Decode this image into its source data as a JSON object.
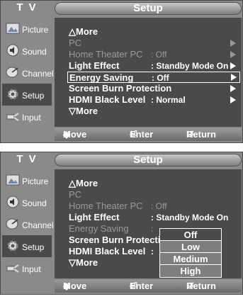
{
  "tv_label": "T V",
  "title": "Setup",
  "sidebar": [
    {
      "label": "Picture"
    },
    {
      "label": "Sound"
    },
    {
      "label": "Channel"
    },
    {
      "label": "Setup"
    },
    {
      "label": "Input"
    }
  ],
  "menu_top": {
    "more_up": "More",
    "items": [
      {
        "label": "PC",
        "value": ""
      },
      {
        "label": "Home Theater PC",
        "value": ": Off"
      },
      {
        "label": "Light Effect",
        "value": ": Standby Mode On"
      },
      {
        "label": "Energy Saving",
        "value": ": Off"
      },
      {
        "label": "Screen Burn Protection",
        "value": ""
      },
      {
        "label": "HDMI Black Level",
        "value": ": Normal"
      }
    ],
    "more_down": "More"
  },
  "menu_bottom": {
    "more_up": "More",
    "items": [
      {
        "label": "PC",
        "value": ""
      },
      {
        "label": "Home Theater PC",
        "value": ": Off"
      },
      {
        "label": "Light Effect",
        "value": ": Standby Mode On"
      },
      {
        "label": "Energy Saving",
        "value": ":"
      },
      {
        "label": "Screen Burn Protectic",
        "value": ""
      },
      {
        "label": "HDMI Black Level",
        "value": ":"
      }
    ],
    "more_down": "More",
    "dropdown_options": [
      "Off",
      "Low",
      "Medium",
      "High"
    ]
  },
  "footer": {
    "move": "Move",
    "enter": "Enter",
    "return": "Return"
  },
  "colors": {
    "panel": "#4a4a4a",
    "frame": "#8a8a8a"
  }
}
